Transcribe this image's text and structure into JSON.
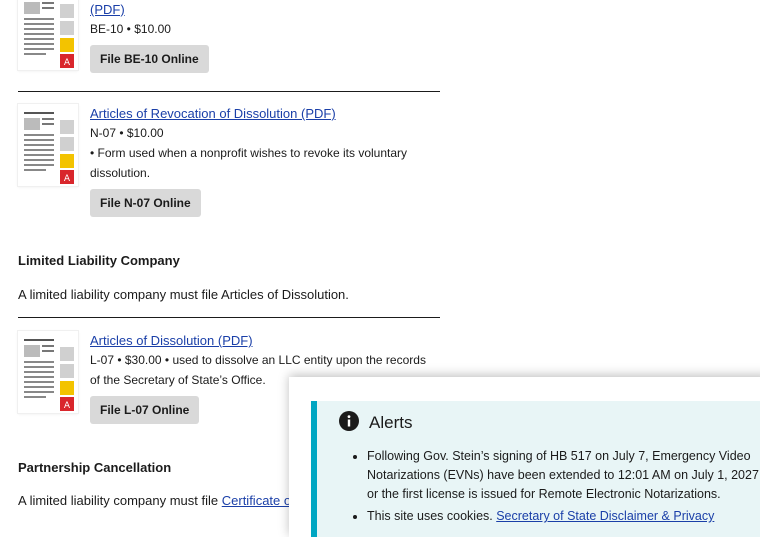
{
  "forms": [
    {
      "link_text": "(PDF)",
      "meta": "BE-10 • $10.00",
      "description": "",
      "button_label": "File BE-10 Online"
    },
    {
      "link_text": "Articles of Revocation of Dissolution (PDF)",
      "meta": "N-07  • $10.00",
      "description": " • Form used when a nonprofit wishes to revoke its voluntary dissolution.",
      "button_label": "File N-07 Online"
    },
    {
      "link_text": "Articles of Dissolution (PDF)",
      "meta": "L-07 • $30.00 • used to dissolve an LLC entity upon the records of the Secretary of State’s Office.",
      "description": "",
      "button_label": "File L-07 Online"
    }
  ],
  "sections": {
    "llc_heading": "Limited Liability Company",
    "llc_text": "A limited liability company must file Articles of Dissolution.",
    "partnership_heading": "Partnership Cancellation",
    "partnership_text": "A limited liability company must file ",
    "partnership_link": "Certificate of"
  },
  "alerts": {
    "title": "Alerts",
    "items": [
      "Following Gov. Stein’s signing of HB 517 on July 7, Emergency Video Notarizations (EVNs) have been extended to 12:01 AM on July 1, 2027 or the first license is issued for Remote Electronic Notarizations.",
      "This site uses cookies. "
    ],
    "cookie_link": "Secretary of State Disclaimer & Privacy",
    "accent_color": "#00a6c2",
    "background_color": "#e8f5f6"
  }
}
